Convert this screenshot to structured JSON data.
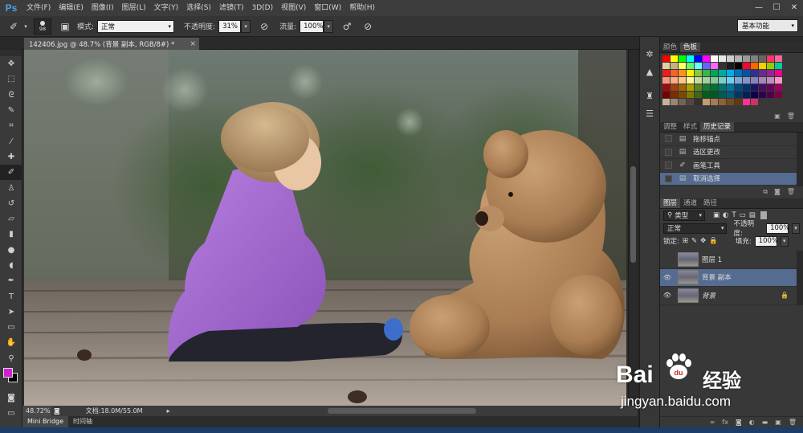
{
  "app": {
    "logo": "Ps",
    "document_tab": "142406.jpg @ 48.7% (背景 副本, RGB/8#) *",
    "window_controls": [
      "—",
      "☐",
      "✕"
    ]
  },
  "menu": [
    "文件(F)",
    "编辑(E)",
    "图像(I)",
    "图层(L)",
    "文字(Y)",
    "选择(S)",
    "滤镜(T)",
    "3D(D)",
    "视图(V)",
    "窗口(W)",
    "帮助(H)"
  ],
  "options": {
    "brush_size": "98",
    "mode_label": "模式:",
    "mode_value": "正常",
    "opacity_label": "不透明度:",
    "opacity_value": "31%",
    "flow_label": "流量:",
    "flow_value": "100%",
    "workspace": "基本功能"
  },
  "tools": [
    {
      "name": "move-tool",
      "glyph": "✥"
    },
    {
      "name": "marquee-tool",
      "glyph": "⬚"
    },
    {
      "name": "lasso-tool",
      "glyph": "ᘓ"
    },
    {
      "name": "quick-select-tool",
      "glyph": "✎"
    },
    {
      "name": "crop-tool",
      "glyph": "⌗"
    },
    {
      "name": "eyedropper-tool",
      "glyph": "⁄"
    },
    {
      "name": "healing-brush-tool",
      "glyph": "✚"
    },
    {
      "name": "brush-tool",
      "glyph": "✐"
    },
    {
      "name": "clone-stamp-tool",
      "glyph": "♙"
    },
    {
      "name": "history-brush-tool",
      "glyph": "↺"
    },
    {
      "name": "eraser-tool",
      "glyph": "▱"
    },
    {
      "name": "gradient-tool",
      "glyph": "▮"
    },
    {
      "name": "blur-tool",
      "glyph": "●"
    },
    {
      "name": "dodge-tool",
      "glyph": "◖"
    },
    {
      "name": "pen-tool",
      "glyph": "✒"
    },
    {
      "name": "type-tool",
      "glyph": "T"
    },
    {
      "name": "path-select-tool",
      "glyph": "➤"
    },
    {
      "name": "shape-tool",
      "glyph": "▭"
    },
    {
      "name": "hand-tool",
      "glyph": "✋"
    },
    {
      "name": "zoom-tool",
      "glyph": "⚲"
    }
  ],
  "status": {
    "zoom": "48.72%",
    "doc_size": "文档:18.0M/55.0M"
  },
  "bottom_tabs": [
    "Mini Bridge",
    "时间轴"
  ],
  "swatch_panel": {
    "tabs": [
      "颜色",
      "色板"
    ],
    "colors": [
      "#ff0000",
      "#ffff00",
      "#00ff00",
      "#00ffff",
      "#0000ff",
      "#ff00ff",
      "#ffffff",
      "#e8e8e8",
      "#cccccc",
      "#b3b3b3",
      "#999999",
      "#808080",
      "#666666",
      "#ff3366",
      "#ff6699",
      "#e6ce9e",
      "#c8b07f",
      "#ffff66",
      "#66ff66",
      "#66ffff",
      "#6666ff",
      "#ff66ff",
      "#333333",
      "#1a1a1a",
      "#000000",
      "#ff0033",
      "#ff6600",
      "#ffcc00",
      "#99cc00",
      "#00cc99",
      "#ed1c24",
      "#f26522",
      "#f7941d",
      "#fff200",
      "#8dc63f",
      "#39b54a",
      "#00a651",
      "#00a99d",
      "#00aeef",
      "#0072bc",
      "#0054a6",
      "#2e3192",
      "#662d91",
      "#92278f",
      "#ec008c",
      "#f7977a",
      "#f9ad81",
      "#fdc68a",
      "#fff79a",
      "#c4df9b",
      "#a3d39c",
      "#82ca9d",
      "#7bcdc8",
      "#6ecff6",
      "#7ea7d8",
      "#8493ca",
      "#8882be",
      "#a187be",
      "#bc8dbf",
      "#f49ac2",
      "#9e0b0f",
      "#a0410d",
      "#a36209",
      "#aba000",
      "#598527",
      "#1a7b30",
      "#007236",
      "#00746b",
      "#0076a3",
      "#004b80",
      "#003471",
      "#1b1464",
      "#440e62",
      "#630460",
      "#9e005d",
      "#790000",
      "#7b2e00",
      "#7d4900",
      "#827b00",
      "#406618",
      "#005e20",
      "#005826",
      "#005952",
      "#005b7f",
      "#003663",
      "#002157",
      "#0d004c",
      "#32004b",
      "#4b0049",
      "#7b0046",
      "#c7b299",
      "#998675",
      "#736357",
      "#534741",
      "#37302a",
      "#c69c6d",
      "#a67c52",
      "#8c6239",
      "#754c24",
      "#603913",
      "#ff3399",
      "#cc3366"
    ]
  },
  "history_panel": {
    "tabs": [
      "调整",
      "样式",
      "历史记录"
    ],
    "items": [
      {
        "label": "拖移锚点",
        "icon": "doc-icon",
        "glyph": "▤"
      },
      {
        "label": "选区更改",
        "icon": "doc-icon",
        "glyph": "▤"
      },
      {
        "label": "画笔工具",
        "icon": "brush-icon",
        "glyph": "✐"
      },
      {
        "label": "取消选择",
        "icon": "doc-icon",
        "glyph": "▤"
      }
    ],
    "selected_index": 3
  },
  "layers_panel": {
    "tabs": [
      "图层",
      "通道",
      "路径"
    ],
    "filter_label": "类型",
    "blend_mode": "正常",
    "opacity_label": "不透明度:",
    "opacity_value": "100%",
    "lock_label": "锁定:",
    "fill_label": "填充:",
    "fill_value": "100%",
    "layers": [
      {
        "name": "图层 1",
        "visible": false,
        "locked": false
      },
      {
        "name": "背景 副本",
        "visible": true,
        "locked": false
      },
      {
        "name": "背景",
        "visible": true,
        "locked": true
      }
    ],
    "selected_index": 1
  },
  "watermark": {
    "brand": "Bai",
    "brand2": "经验",
    "url": "jingyan.baidu.com"
  }
}
